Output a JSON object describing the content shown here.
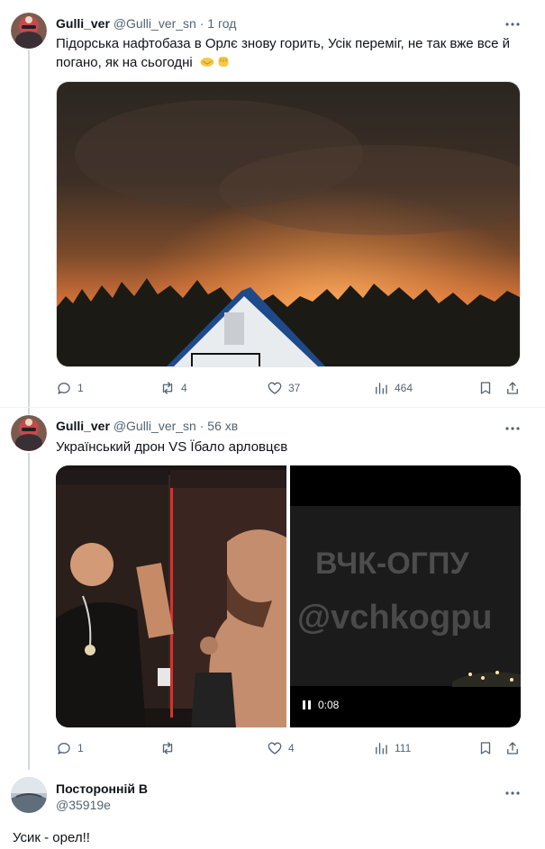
{
  "tweets": [
    {
      "name": "Gulli_ver",
      "handle": "@Gulli_ver_sn",
      "dot": "·",
      "time": "1 год",
      "text": "Підорська нафтобаза в Орлє знову горить, Усік переміг, не так вже все й погано, як на сьогодні",
      "emoji": [
        "handshake-emoji",
        "fist-emoji"
      ],
      "stats": {
        "replies": "1",
        "retweets": "4",
        "likes": "37",
        "views": "464"
      }
    },
    {
      "name": "Gulli_ver",
      "handle": "@Gulli_ver_sn",
      "dot": "·",
      "time": "56 хв",
      "text": "Український дрон VS Їбало арловцєв",
      "video": {
        "watermark_line1": "ВЧК-ОГПУ",
        "watermark_line2": "@vchkogpu",
        "time": "0:08"
      },
      "stats": {
        "replies": "1",
        "retweets": "",
        "likes": "4",
        "views": "111"
      }
    }
  ],
  "reply": {
    "name": "Посторонній В",
    "handle": "@35919e",
    "text": "Усик - орел!!"
  },
  "colors": {
    "text": "#0f1419",
    "secondary": "#536471",
    "line": "#cfd9de"
  }
}
